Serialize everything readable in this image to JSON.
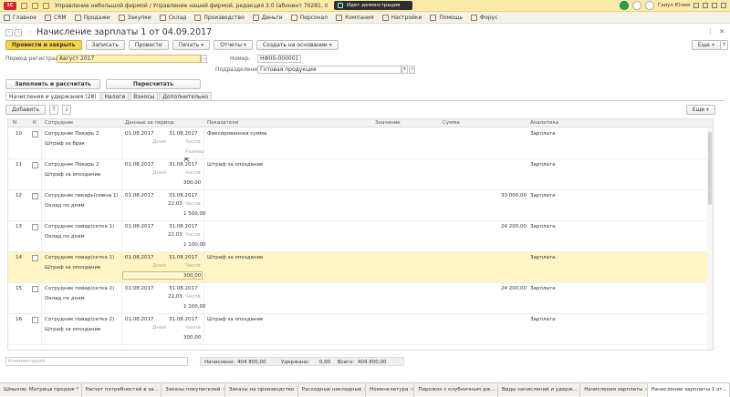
{
  "titlebar": {
    "app_logo": "1С",
    "title": "Управление небольшой фирмой / Управление нашей фирмой, редакция 3.0 (абонент 70281, приложение 394709) (1С:Предпр",
    "demo_label": "Идет демонстрация",
    "user": "Гаиул Юлия"
  },
  "menu": {
    "items": [
      {
        "label": "Главное"
      },
      {
        "label": "CRM"
      },
      {
        "label": "Продажи"
      },
      {
        "label": "Закупки"
      },
      {
        "label": "Склад"
      },
      {
        "label": "Производство"
      },
      {
        "label": "Деньги"
      },
      {
        "label": "Персонал"
      },
      {
        "label": "Компания"
      },
      {
        "label": "Настройки"
      },
      {
        "label": "Помощь"
      },
      {
        "label": "Форус"
      }
    ]
  },
  "document": {
    "title": "Начисление зарплаты 1 от 04.09.2017",
    "window_controls": [
      "⋮",
      "✕"
    ]
  },
  "toolbar": {
    "post_close": "Провести и закрыть",
    "save": "Записать",
    "post": "Провести",
    "print": "Печать",
    "reports": "Отчеты",
    "create_based": "Создать на основании",
    "more": "Еще",
    "help": "?"
  },
  "fields": {
    "period_label": "Период регистрации:",
    "period_value": "Август 2017",
    "number_label": "Номер:",
    "number_value": "НФ00-000001",
    "dept_label": "Подразделение:",
    "dept_value": "Готовая продукция"
  },
  "actions": {
    "fill_calc": "Заполнить и рассчитать",
    "recalc": "Пересчитать"
  },
  "tabs": [
    {
      "label": "Начисления и удержания (28)"
    },
    {
      "label": "Налоги"
    },
    {
      "label": "Взносы"
    },
    {
      "label": "Дополнительно"
    }
  ],
  "grid_toolbar": {
    "add": "Добавить",
    "up": "↑",
    "down": "↓",
    "more": "Еще"
  },
  "grid": {
    "columns": {
      "n": "N",
      "k": "К",
      "employee": "Сотрудник",
      "period": "Данные за период",
      "indicators": "Показатели",
      "value": "Значение",
      "sum": "Сумма",
      "analytics": "Аналитика"
    },
    "rows": [
      {
        "n": "10",
        "employee": "Сотрудник Пекарь 2",
        "kind": "Штраф за брак",
        "from": "01.08.2017",
        "to": "31.08.2017",
        "days_label": "Дней",
        "days": "",
        "hours_label": "Часов",
        "hours": "",
        "result_label": "Размер",
        "result": "",
        "indicator": "Фиксированная сумма",
        "sum": "",
        "analytics": "Зарплата"
      },
      {
        "n": "11",
        "employee": "Сотрудник Пекарь 2",
        "kind": "Штраф за опоздание",
        "from": "01.08.2017",
        "to": "31.08.2017",
        "days_label": "Дней",
        "days": "",
        "hours_label": "Часов",
        "hours": "",
        "result_label": "",
        "result": "300,00",
        "indicator": "Штраф за опоздание",
        "sum": "",
        "analytics": "Зарплата"
      },
      {
        "n": "12",
        "employee": "Сотрудник пекарь(смена 1)",
        "kind": "Оклад по дням",
        "from": "01.08.2017",
        "to": "31.08.2017",
        "days_label": "",
        "days": "22,03",
        "hours_label": "Часов",
        "hours": "",
        "result_label": "",
        "result": "1 500,00",
        "indicator": "",
        "sum": "33 000,00",
        "analytics": "Зарплата"
      },
      {
        "n": "13",
        "employee": "Сотрудник повар(сетка 1)",
        "kind": "Оклад по дням",
        "from": "01.08.2017",
        "to": "31.08.2017",
        "days_label": "",
        "days": "22,03",
        "hours_label": "Часов",
        "hours": "",
        "result_label": "",
        "result": "1 100,00",
        "indicator": "",
        "sum": "24 200,00",
        "analytics": "Зарплата"
      },
      {
        "n": "14",
        "employee": "Сотрудник повар(сетка 1)",
        "kind": "Штраф за опоздание",
        "from": "01.08.2017",
        "to": "31.08.2017",
        "days_label": "Дней",
        "days": "",
        "hours_label": "Часов",
        "hours": "",
        "result_label": "",
        "result": "300,00",
        "indicator": "Штраф за опоздание",
        "sum": "",
        "analytics": "Зарплата",
        "selected": true
      },
      {
        "n": "15",
        "employee": "Сотрудник повар(сетка 2)",
        "kind": "Оклад по дням",
        "from": "01.08.2017",
        "to": "31.08.2017",
        "days_label": "",
        "days": "22,03",
        "hours_label": "Часов",
        "hours": "",
        "result_label": "",
        "result": "1 100,00",
        "indicator": "",
        "sum": "24 200,00",
        "analytics": "Зарплата"
      },
      {
        "n": "16",
        "employee": "Сотрудник повар(сетка 2)",
        "kind": "Штраф за опоздание",
        "from": "01.08.2017",
        "to": "31.08.2017",
        "days_label": "Дней",
        "days": "",
        "hours_label": "Часов",
        "hours": "",
        "result_label": "",
        "result": "300,00",
        "indicator": "Штраф за опоздание",
        "sum": "",
        "analytics": "Зарплата"
      }
    ]
  },
  "footer": {
    "comment_placeholder": "Комментарий",
    "accrued_label": "Начислено:",
    "accrued": "404 800,00",
    "withheld_label": "Удержано:",
    "withheld": "0,00",
    "total_label": "Всего:",
    "total": "404 800,00"
  },
  "taskbar": [
    {
      "label": "Шмыков: Матрица продаж *"
    },
    {
      "label": "Расчет потребностей в за..."
    },
    {
      "label": "Заказы покупателей"
    },
    {
      "label": "Заказы на производство"
    },
    {
      "label": "Расходные накладные"
    },
    {
      "label": "Номенклатура"
    },
    {
      "label": "Пирожок с клубничным дж..."
    },
    {
      "label": "Виды начислений и удерж..."
    },
    {
      "label": "Начисления зарплаты"
    },
    {
      "label": "Начисление зарплаты 1 от..."
    }
  ]
}
